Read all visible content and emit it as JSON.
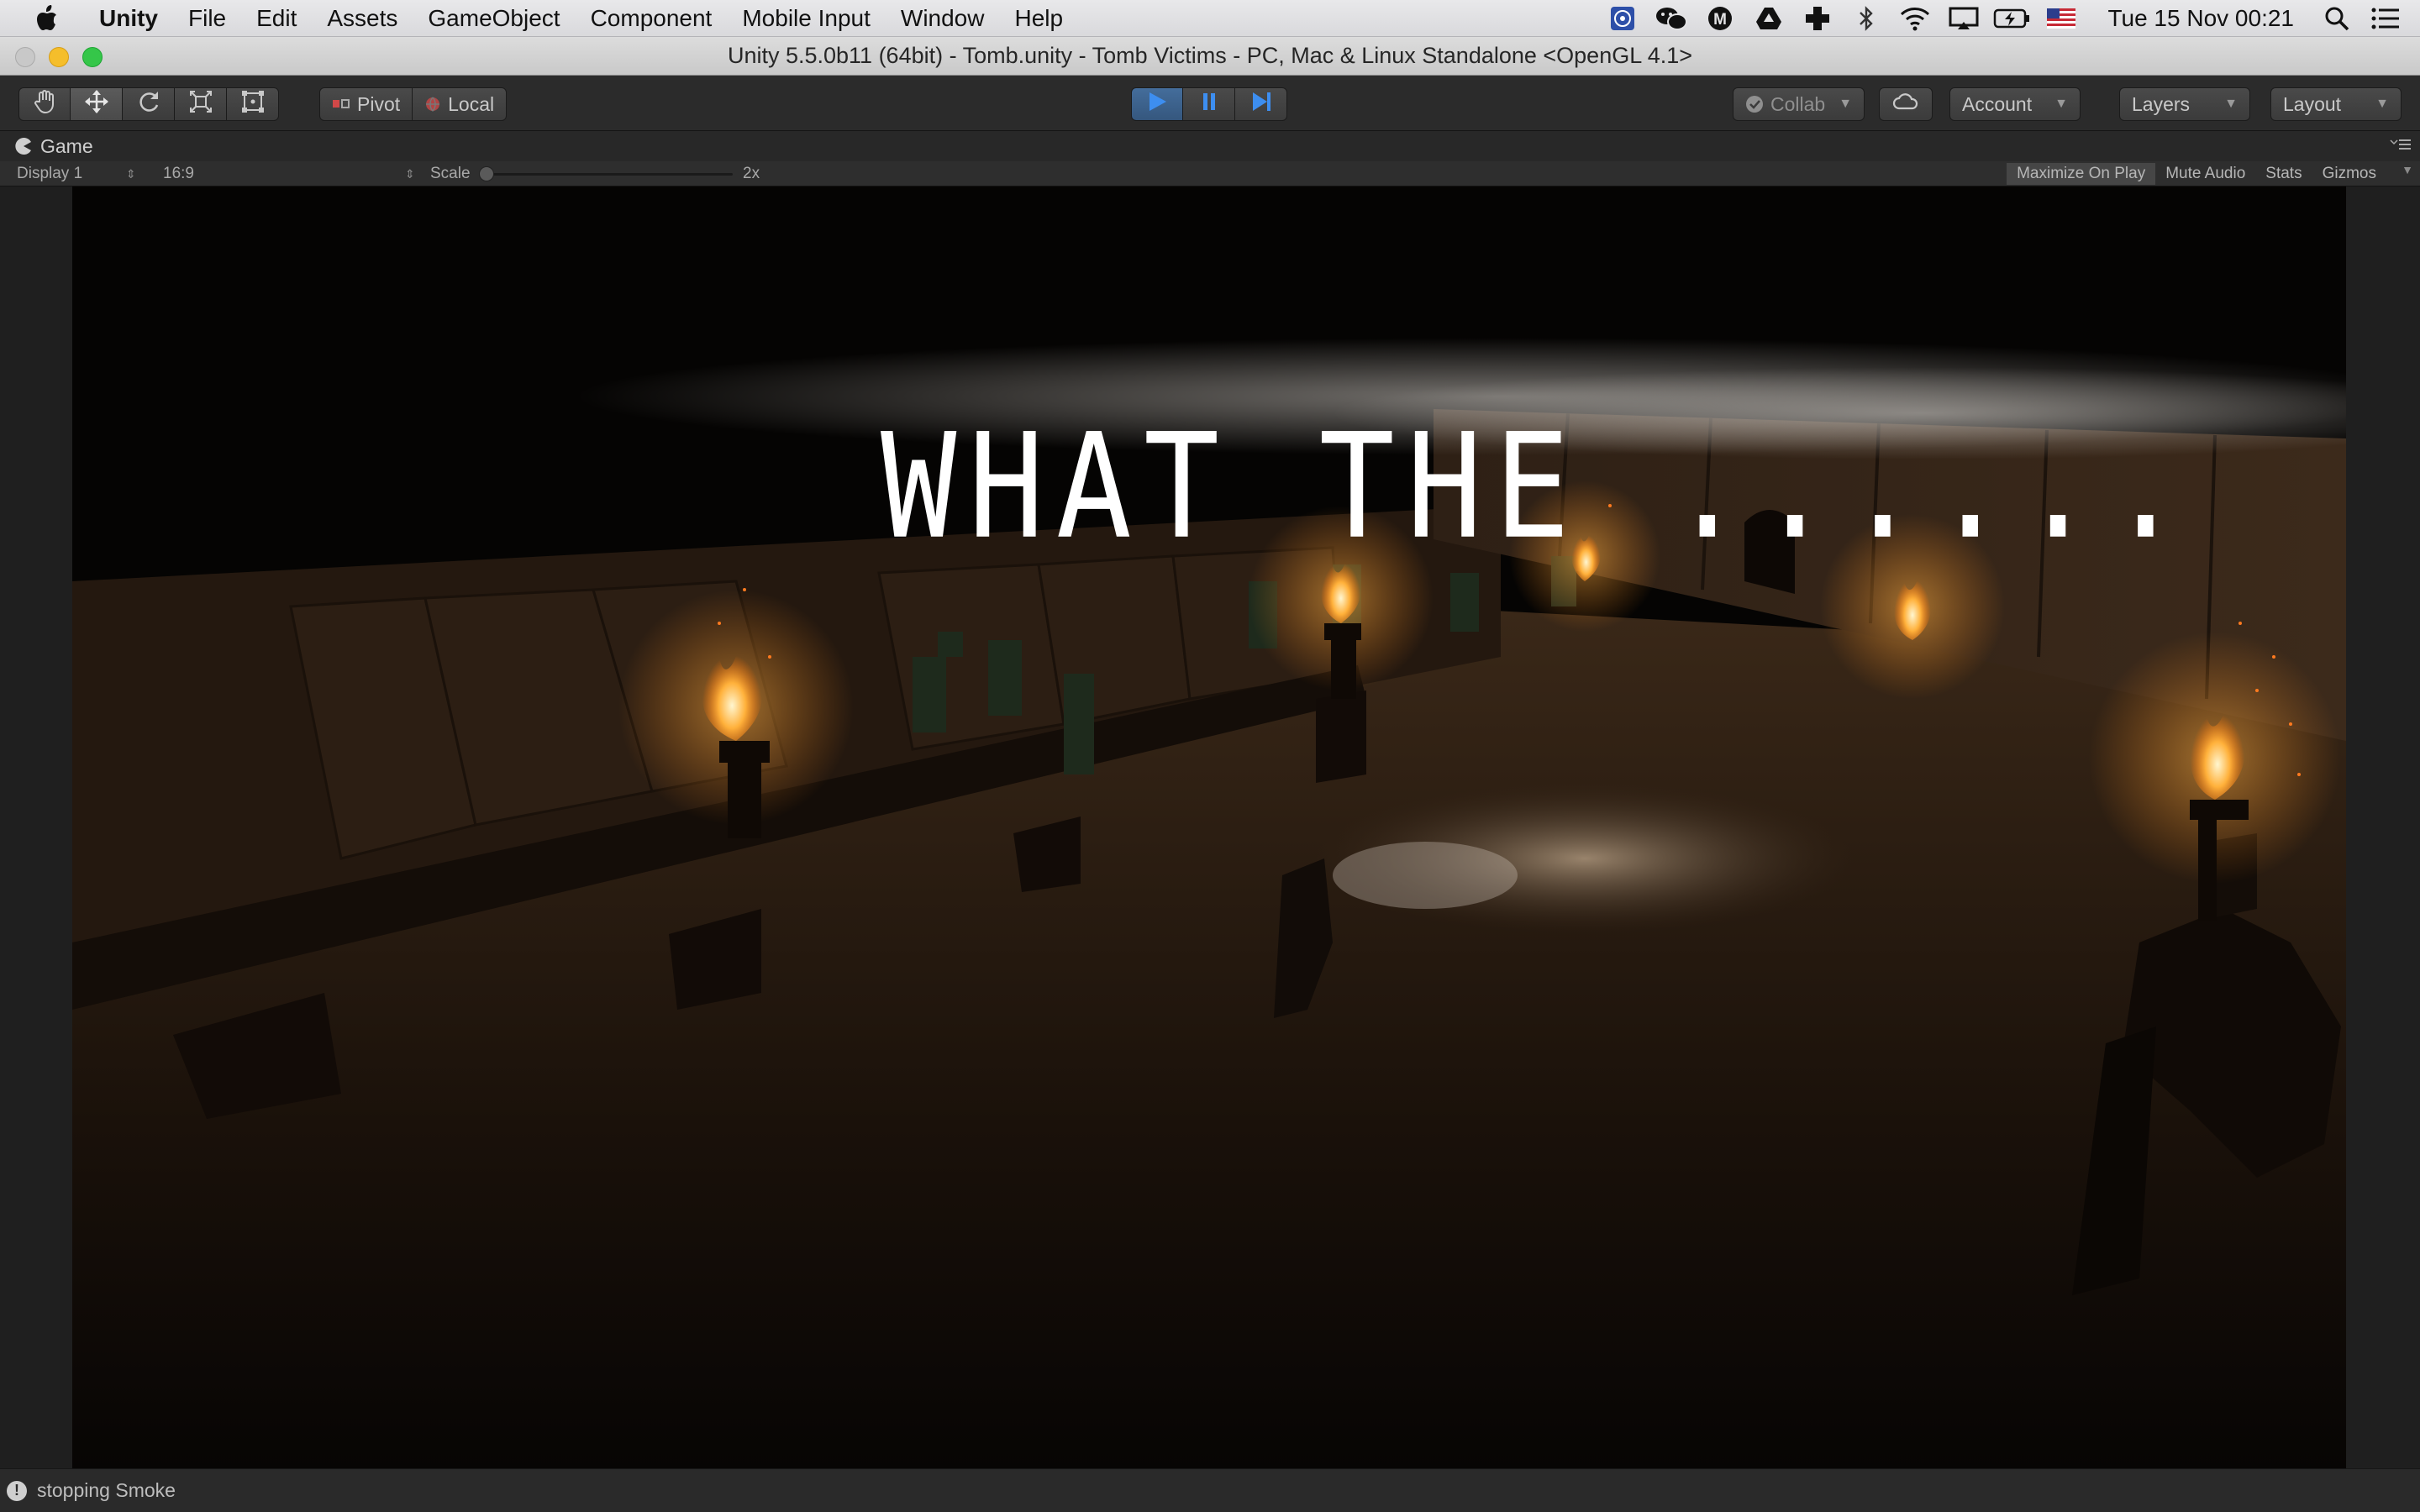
{
  "menubar": {
    "apple_icon": "apple-logo-icon",
    "items": [
      "Unity",
      "File",
      "Edit",
      "Assets",
      "GameObject",
      "Component",
      "Mobile Input",
      "Window",
      "Help"
    ],
    "tray_icons": [
      "accessibility-icon",
      "wechat-icon",
      "m-app-icon",
      "google-drive-icon",
      "crosshair-app-icon",
      "bluetooth-icon",
      "wifi-icon",
      "airplay-icon",
      "battery-charging-icon",
      "us-flag-icon"
    ],
    "clock": "Tue 15 Nov  00:21",
    "search_icon": "spotlight-search-icon",
    "notification_icon": "notification-center-icon"
  },
  "window": {
    "title": "Unity 5.5.0b11 (64bit) - Tomb.unity - Tomb Victims - PC, Mac & Linux Standalone <OpenGL 4.1>"
  },
  "toolbar": {
    "transform_tools": [
      "hand-tool-icon",
      "move-tool-icon",
      "rotate-tool-icon",
      "scale-tool-icon",
      "rect-tool-icon"
    ],
    "pivot_label": "Pivot",
    "local_label": "Local",
    "playback": [
      "play-icon",
      "pause-icon",
      "step-icon"
    ],
    "collab_label": "Collab",
    "account_label": "Account",
    "layers_label": "Layers",
    "layout_label": "Layout"
  },
  "game_panel": {
    "tab_label": "Game",
    "display_label": "Display 1",
    "aspect_label": "16:9",
    "scale_label": "Scale",
    "scale_value": "2x",
    "scale_slider_fraction": 0,
    "toggles": {
      "maximize_on_play": "Maximize On Play",
      "mute_audio": "Mute Audio",
      "stats": "Stats",
      "gizmos": "Gizmos"
    },
    "game_text": "WHAT THE ......"
  },
  "status": {
    "message": "stopping Smoke"
  },
  "colors": {
    "play_active": "#3d6aa0",
    "editor_dark": "#2b2b2b",
    "torch_flame": "#ff9a2e"
  }
}
